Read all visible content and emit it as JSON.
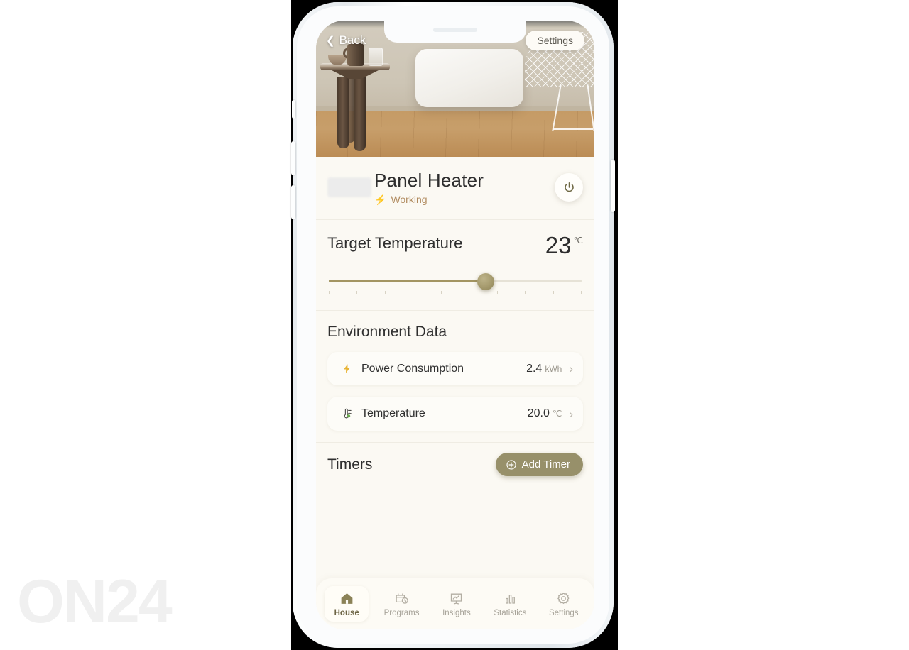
{
  "watermark": {
    "text": "ON24"
  },
  "hero": {
    "back_label": "Back",
    "back_icon": "chevron-left-icon",
    "settings_label": "Settings",
    "scene_alt": "panel heater on beige wall above wooden floor with side table and wire chair"
  },
  "device": {
    "name": "Panel Heater",
    "status_text": "Working",
    "status_icon": "lightning-bolt-icon",
    "power_icon": "power-icon",
    "logo_placeholder": ""
  },
  "target_temperature": {
    "label": "Target Temperature",
    "value": "23",
    "unit": "℃",
    "slider_percent": 62,
    "tick_count": 10
  },
  "environment": {
    "title": "Environment Data",
    "rows": [
      {
        "icon": "lightning-bolt-icon",
        "name": "Power Consumption",
        "value": "2.4",
        "unit": "kWh",
        "chevron": "chevron-right-icon"
      },
      {
        "icon": "thermometer-icon",
        "name": "Temperature",
        "value": "20.0",
        "unit": "℃",
        "chevron": "chevron-right-icon"
      }
    ]
  },
  "timers": {
    "title": "Timers",
    "add_label": "Add Timer",
    "add_icon": "plus-circle-icon"
  },
  "tabbar": {
    "items": [
      {
        "label": "House",
        "icon": "home-icon",
        "active": true
      },
      {
        "label": "Programs",
        "icon": "calendar-clock-icon",
        "active": false
      },
      {
        "label": "Insights",
        "icon": "presentation-chart-icon",
        "active": false
      },
      {
        "label": "Statistics",
        "icon": "bar-chart-icon",
        "active": false
      },
      {
        "label": "Settings",
        "icon": "gear-icon",
        "active": false
      }
    ]
  },
  "colors": {
    "accent_olive": "#97906a",
    "status_orange": "#c8703a",
    "status_text": "#b08a5e",
    "bg_cream": "#fbf9f3",
    "card": "#fdfcf8",
    "bolt_yellow": "#e8b434",
    "thermo_green": "#6aa84f"
  }
}
